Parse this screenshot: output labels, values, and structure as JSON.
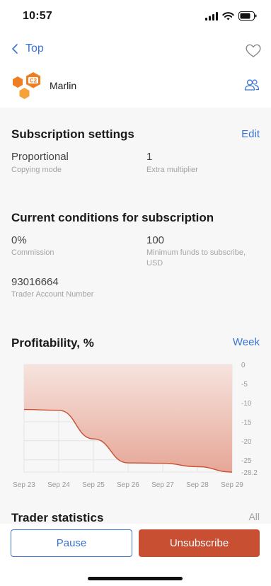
{
  "status": {
    "time": "10:57"
  },
  "nav": {
    "back_label": "Top"
  },
  "trader": {
    "name": "Marlin",
    "logo_text": "C2"
  },
  "subscription": {
    "title": "Subscription settings",
    "edit_label": "Edit",
    "copying_mode_value": "Proportional",
    "copying_mode_label": "Copying mode",
    "multiplier_value": "1",
    "multiplier_label": "Extra multiplier"
  },
  "conditions": {
    "title": "Current conditions for subscription",
    "commission_value": "0%",
    "commission_label": "Commission",
    "min_funds_value": "100",
    "min_funds_label_line1": "Minimum funds to subscribe,",
    "min_funds_label_line2": "USD",
    "account_value": "93016664",
    "account_label": "Trader Account Number"
  },
  "profitability": {
    "title": "Profitability, %",
    "period_label": "Week"
  },
  "chart_data": {
    "type": "area",
    "x": [
      "Sep 23",
      "Sep 24",
      "Sep 25",
      "Sep 26",
      "Sep 27",
      "Sep 28",
      "Sep 29"
    ],
    "series": [
      {
        "values": [
          -11.8,
          -12.0,
          -19.5,
          -25.8,
          -25.9,
          -26.8,
          -28.2
        ]
      }
    ],
    "y_ticks": [
      "0",
      "-5",
      "-10",
      "-15",
      "-20",
      "-25",
      "-28.2"
    ],
    "ylim": [
      -28.2,
      0
    ],
    "grid": true,
    "colors": {
      "line": "#c94f33",
      "fill_top": "#f6e3de",
      "fill_bottom": "#e6a797"
    }
  },
  "statistics": {
    "title": "Trader statistics",
    "all_label": "All"
  },
  "buttons": {
    "pause_label": "Pause",
    "unsubscribe_label": "Unsubscribe"
  },
  "colors": {
    "accent": "#3b73d1",
    "danger": "#c94f33",
    "logo": "#ef7d22"
  }
}
